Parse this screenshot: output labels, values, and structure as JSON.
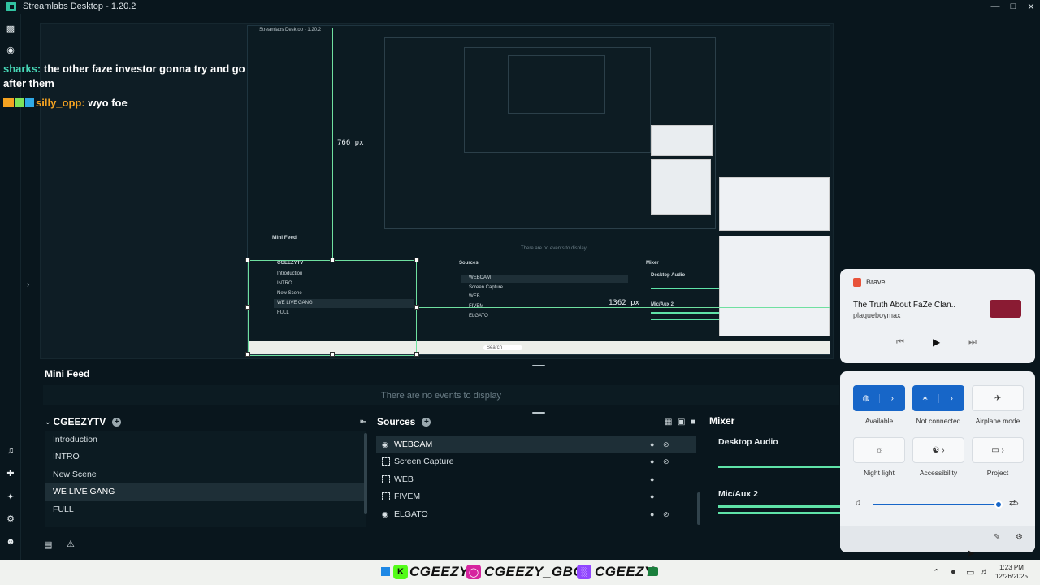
{
  "window": {
    "title": "Streamlabs Desktop - 1.20.2"
  },
  "chat": {
    "messages": [
      {
        "user": "sharks:",
        "text": "the other faze investor gonna try and go after them"
      },
      {
        "user": "silly_opp:",
        "text": "wyo foe"
      }
    ]
  },
  "preview": {
    "inner_title": "Streamlabs Desktop - 1.20.2",
    "dim_vertical": "766 px",
    "dim_horizontal": "1362 px",
    "mini_feed_title": "Mini Feed",
    "mini_feed_empty": "There are no events to display",
    "scene_collection": "CGEEZYTV",
    "scenes": [
      "Introduction",
      "INTRO",
      "New Scene",
      "WE LIVE GANG",
      "FULL"
    ],
    "sources_title": "Sources",
    "sources": [
      "WEBCAM",
      "Screen Capture",
      "WEB",
      "FIVEM",
      "ELGATO"
    ],
    "mixer_title": "Mixer",
    "mixer": [
      "Desktop Audio",
      "Mic/Aux 2"
    ],
    "search_placeholder": "Search"
  },
  "mini_feed": {
    "title": "Mini Feed",
    "empty_text": "There are no events to display"
  },
  "scenes": {
    "collection_name": "CGEEZYTV",
    "items": [
      "Introduction",
      "INTRO",
      "New Scene",
      "WE LIVE GANG",
      "FULL"
    ],
    "active_index": 3
  },
  "sources": {
    "title": "Sources",
    "items": [
      {
        "name": "WEBCAM",
        "icon": "webcam-icon",
        "eye": true
      },
      {
        "name": "Screen Capture",
        "icon": "screen-capture-icon",
        "eye": true
      },
      {
        "name": "WEB",
        "icon": "browser-source-icon",
        "eye": false
      },
      {
        "name": "FIVEM",
        "icon": "game-capture-icon",
        "eye": false
      },
      {
        "name": "ELGATO",
        "icon": "webcam-icon",
        "eye": true
      }
    ],
    "active_index": 0
  },
  "mixer": {
    "title": "Mixer",
    "channels": [
      "Desktop Audio",
      "Mic/Aux 2"
    ]
  },
  "media_flyout": {
    "app": "Brave",
    "track_title": "The Truth About FaZe Clan..",
    "artist": "plaqueboymax"
  },
  "quick_settings": {
    "tiles": [
      {
        "label": "Available",
        "icon": "wifi-icon",
        "on": true
      },
      {
        "label": "Not connected",
        "icon": "bluetooth-icon",
        "on": true
      },
      {
        "label": "Airplane mode",
        "icon": "airplane-icon",
        "on": false
      },
      {
        "label": "Night light",
        "icon": "brightness-icon",
        "on": false
      },
      {
        "label": "Accessibility",
        "icon": "accessibility-icon",
        "on": false
      },
      {
        "label": "Project",
        "icon": "project-icon",
        "on": false
      }
    ],
    "volume_level": 0.96
  },
  "taskbar": {
    "brands": [
      "CGEEZY",
      "CGEEZY_GBC",
      "CGEEZY"
    ],
    "time": "1:23 PM",
    "date": "12/26/2025"
  },
  "colors": {
    "background": "#09161d",
    "accent": "#31c3a2",
    "guide": "#6fe0a0",
    "windows_blue": "#1766c8"
  }
}
